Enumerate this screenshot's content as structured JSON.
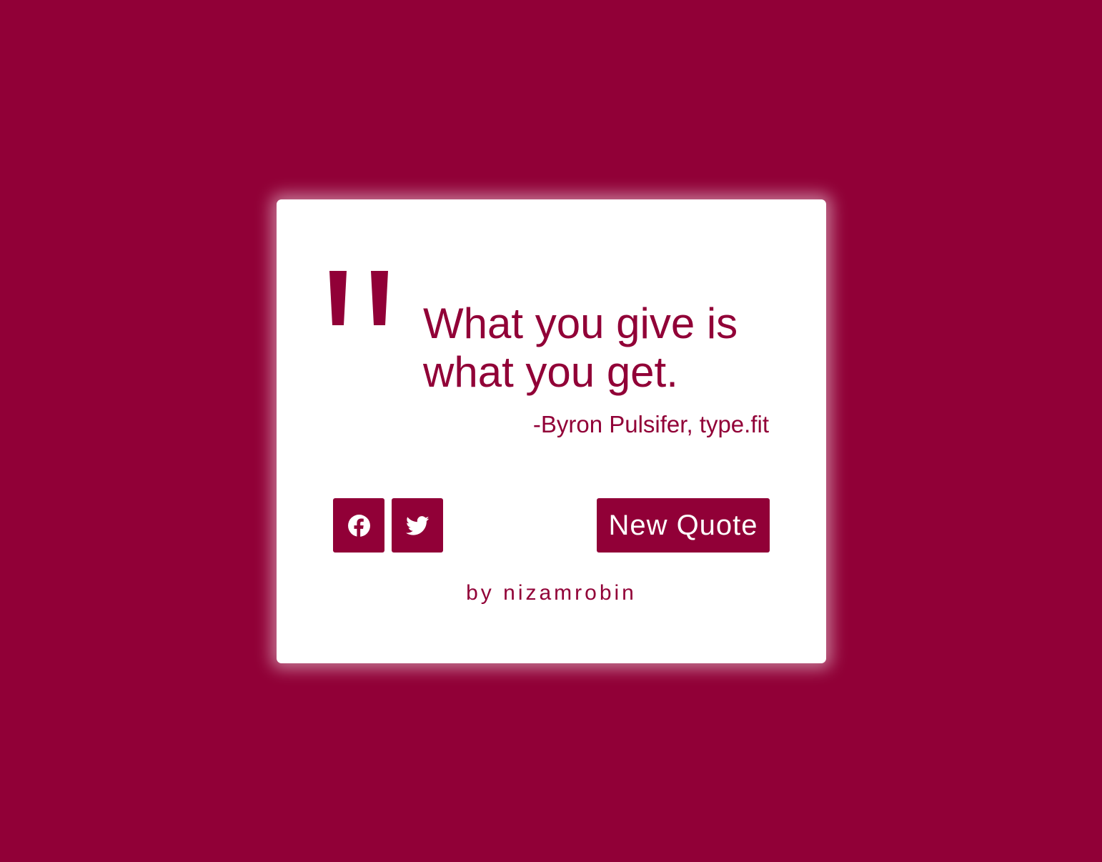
{
  "theme": {
    "accent": "#910037",
    "card_background": "#ffffff"
  },
  "quote": {
    "icon": "quote-left-icon",
    "text": "What you give is what you get.",
    "author": "-Byron Pulsifer, type.fit"
  },
  "actions": {
    "facebook_icon": "facebook-icon",
    "twitter_icon": "twitter-icon",
    "new_quote_label": "New Quote"
  },
  "footer": {
    "credit": "by nizamrobin"
  }
}
